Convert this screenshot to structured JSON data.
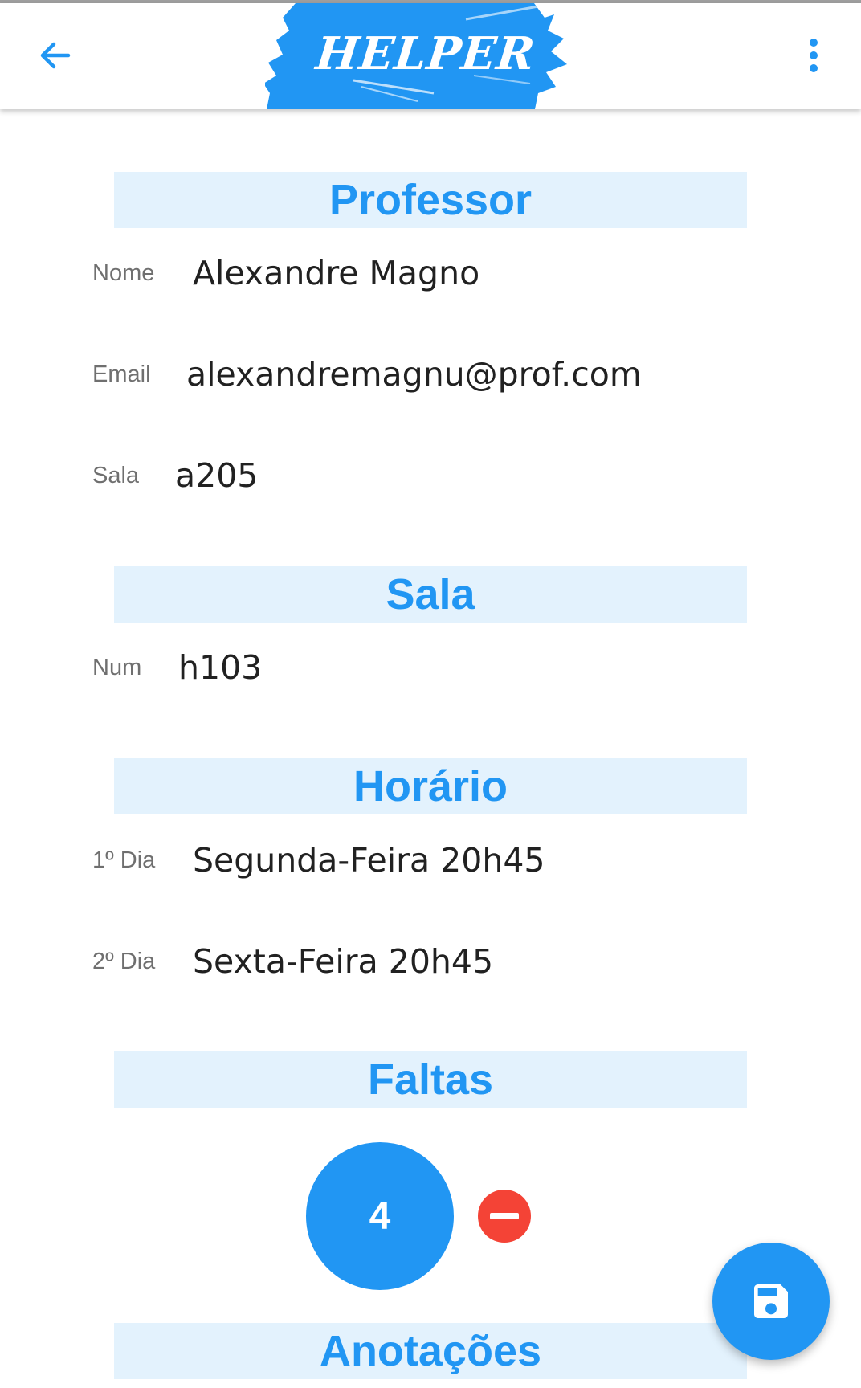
{
  "app": {
    "logo_text": "HELPER",
    "accent_color": "#2196f3",
    "section_bg_color": "#e3f2fd",
    "danger_color": "#f44336"
  },
  "toolbar": {
    "back_icon": "arrow-left-icon",
    "menu_icon": "more-vert-icon"
  },
  "professor": {
    "header": "Professor",
    "fields": [
      {
        "label": "Nome",
        "value": "Alexandre Magno"
      },
      {
        "label": "Email",
        "value": "alexandremagnu@prof.com"
      },
      {
        "label": "Sala",
        "value": "a205"
      }
    ]
  },
  "sala": {
    "header": "Sala",
    "fields": [
      {
        "label": "Num",
        "value": "h103"
      }
    ]
  },
  "horario": {
    "header": "Horário",
    "fields": [
      {
        "label": "1º Dia",
        "value": "Segunda-Feira 20h45"
      },
      {
        "label": "2º Dia",
        "value": "Sexta-Feira 20h45"
      }
    ]
  },
  "faltas": {
    "header": "Faltas",
    "count": "4",
    "decrement_icon": "minus-circle-icon"
  },
  "anotacoes": {
    "header": "Anotações"
  },
  "fab": {
    "icon": "save-icon"
  }
}
